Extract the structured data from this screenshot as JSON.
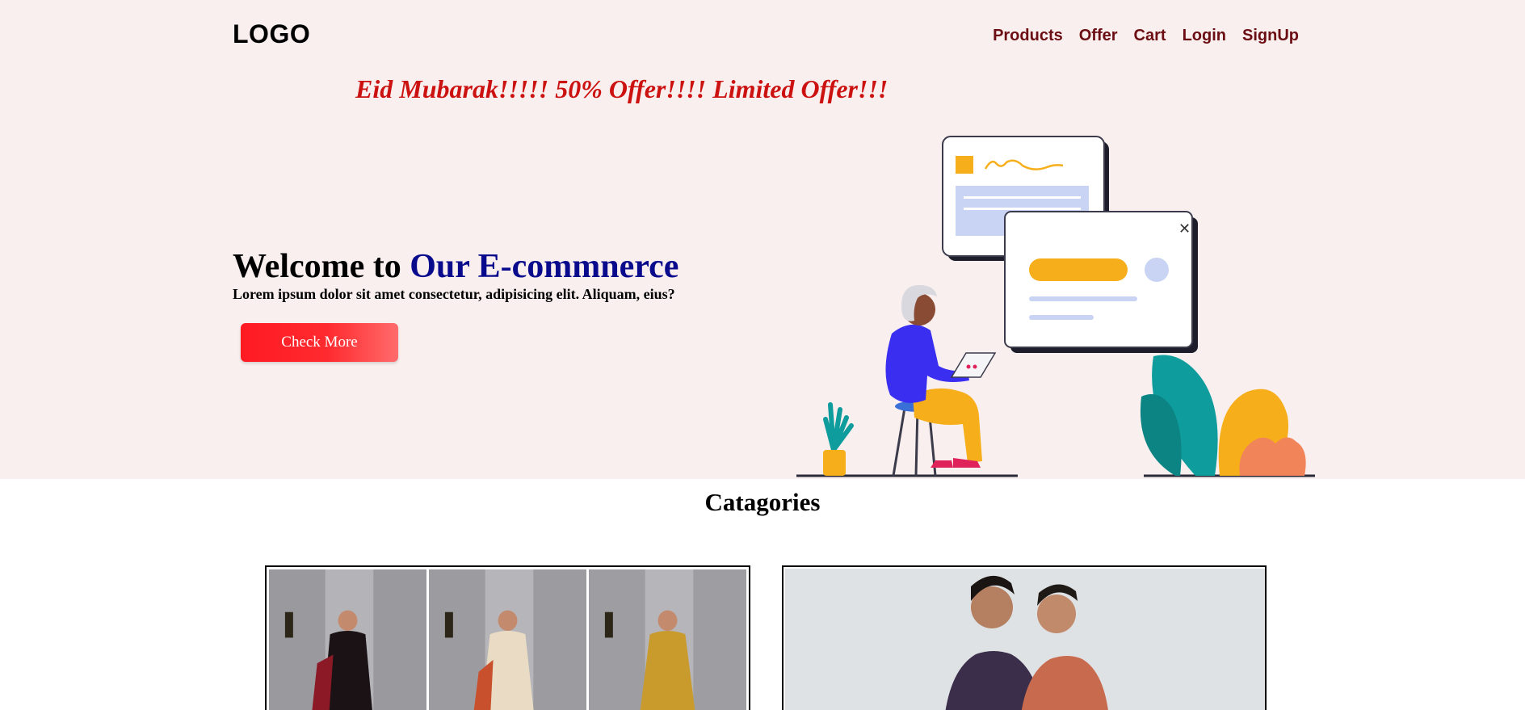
{
  "header": {
    "logo": "LOGO",
    "nav": [
      "Products",
      "Offer",
      "Cart",
      "Login",
      "SignUp"
    ]
  },
  "banner": {
    "marquee": "Eid Mubarak!!!!! 50% Offer!!!! Limited Offer!!!"
  },
  "hero": {
    "title_prefix": "Welcome to ",
    "title_accent": "Our E-commnerce",
    "subtitle": "Lorem ipsum dolor sit amet consectetur, adipisicing elit. Aliquam, eius?",
    "cta_label": "Check More"
  },
  "categories": {
    "heading": "Catagories"
  },
  "colors": {
    "hero_bg": "#f9efee",
    "nav_link": "#6b0d12",
    "marquee": "#cc1111",
    "accent": "#0a0a8c",
    "cta": "#ff1a22"
  }
}
